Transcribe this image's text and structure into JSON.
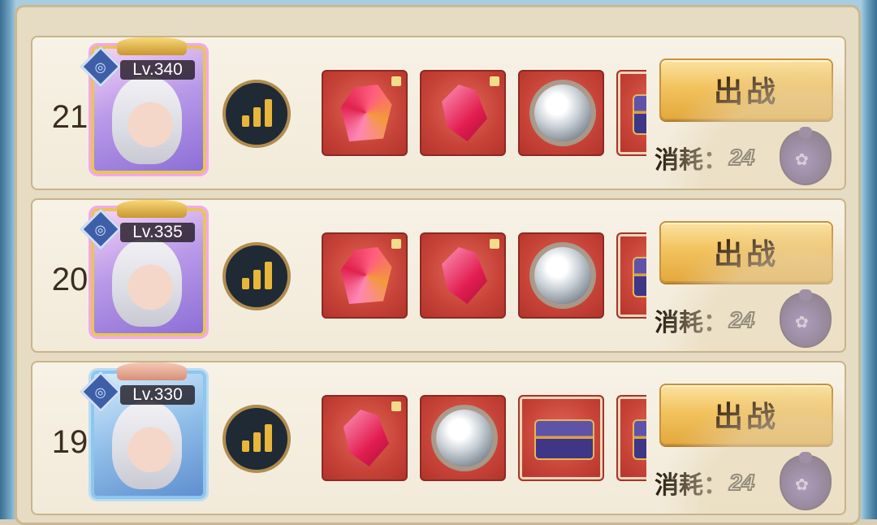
{
  "rows": [
    {
      "rank": "21",
      "level": "Lv.340",
      "portrait_frame": "pink",
      "rewards": [
        "crystal-ore",
        "crystal-shard",
        "spirit-orb",
        "treasure-chest"
      ],
      "fight_label": "出战",
      "cost_label": "消耗：",
      "cost_value": "24"
    },
    {
      "rank": "20",
      "level": "Lv.335",
      "portrait_frame": "pink",
      "rewards": [
        "crystal-ore",
        "crystal-shard",
        "spirit-orb",
        "treasure-chest"
      ],
      "fight_label": "出战",
      "cost_label": "消耗：",
      "cost_value": "24"
    },
    {
      "rank": "19",
      "level": "Lv.330",
      "portrait_frame": "blue",
      "rewards": [
        "crystal-shard",
        "spirit-orb",
        "treasure-chest",
        "treasure-chest"
      ],
      "fight_label": "出战",
      "cost_label": "消耗：",
      "cost_value": "24"
    }
  ],
  "colors": {
    "reward_bg": "#c74338",
    "button_gold": "#f2c35f",
    "panel_bg": "#f7f2e6"
  }
}
